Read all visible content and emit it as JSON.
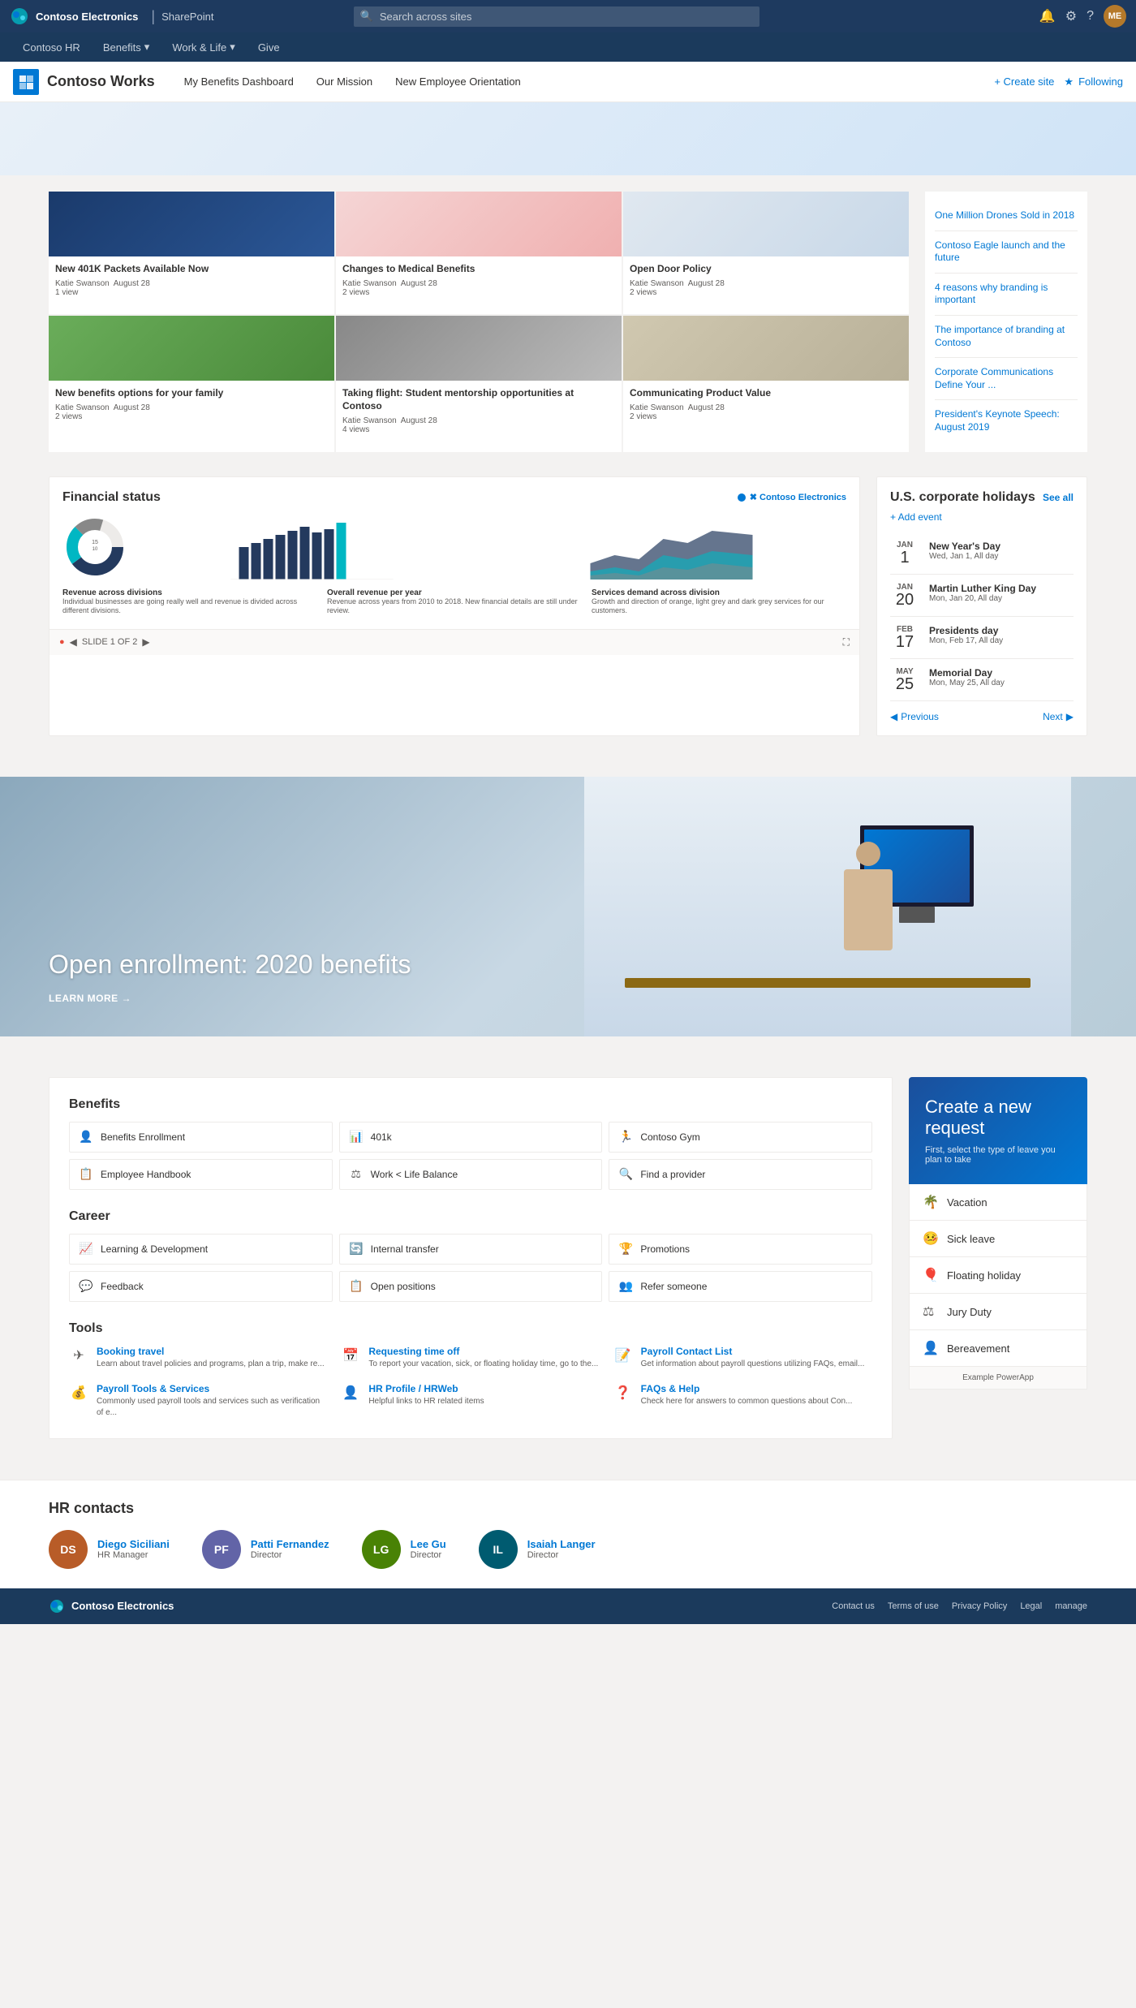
{
  "topNav": {
    "logoText": "Contoso Electronics",
    "divider": "|",
    "sharePointLabel": "SharePoint",
    "searchPlaceholder": "Search across sites",
    "icons": {
      "bell": "🔔",
      "gear": "⚙",
      "help": "?"
    },
    "avatarInitials": "ME"
  },
  "siteNav": {
    "items": [
      {
        "label": "Contoso HR",
        "hasDropdown": false
      },
      {
        "label": "Benefits",
        "hasDropdown": true
      },
      {
        "label": "Work & Life",
        "hasDropdown": true
      },
      {
        "label": "Give",
        "hasDropdown": false
      }
    ]
  },
  "pageNav": {
    "brand": "Contoso Works",
    "links": [
      "My Benefits Dashboard",
      "Our Mission",
      "New Employee Orientation"
    ],
    "createSite": "+ Create site",
    "follow": "Following"
  },
  "news": {
    "items": [
      {
        "title": "New 401K Packets Available Now",
        "author": "Katie Swanson",
        "date": "August 28",
        "views": "1 view",
        "imgType": "blue"
      },
      {
        "title": "Changes to Medical Benefits",
        "author": "Katie Swanson",
        "date": "August 28",
        "views": "2 views",
        "imgType": "baby"
      },
      {
        "title": "Open Door Policy",
        "author": "Katie Swanson",
        "date": "August 28",
        "views": "2 views",
        "imgType": "laptop"
      },
      {
        "title": "New benefits options for your family",
        "author": "Katie Swanson",
        "date": "August 28",
        "views": "2 views",
        "imgType": "family"
      },
      {
        "title": "Taking flight: Student mentorship opportunities at Contoso",
        "author": "Katie Swanson",
        "date": "August 28",
        "views": "4 views",
        "imgType": "meeting"
      },
      {
        "title": "Communicating Product Value",
        "author": "Katie Swanson",
        "date": "August 28",
        "views": "2 views",
        "imgType": "office"
      }
    ],
    "sidebar": [
      "One Million Drones Sold in 2018",
      "Contoso Eagle launch and the future",
      "4 reasons why branding is important",
      "The importance of branding at Contoso",
      "Corporate Communications Define Your ...",
      "President's Keynote Speech: August 2019"
    ]
  },
  "financial": {
    "title": "Financial status",
    "logoText": "✖ Contoso Electronics",
    "captions": [
      {
        "title": "Revenue across divisions",
        "text": "Individual businesses are going really well and revenue is divided across different divisions."
      },
      {
        "title": "Overall revenue per year",
        "text": "Revenue across years from 2010 to 2018. New financial details are still under review."
      },
      {
        "title": "Services demand across division",
        "text": "Growth and direction of orange, light grey and dark grey services for our customers."
      }
    ],
    "slide": "SLIDE 1 OF 2"
  },
  "calendar": {
    "title": "U.S. corporate holidays",
    "seeAll": "See all",
    "addEvent": "+ Add event",
    "events": [
      {
        "month": "JAN",
        "day": "1",
        "name": "New Year's Day",
        "sub": "Wed, Jan 1, All day"
      },
      {
        "month": "JAN",
        "day": "20",
        "name": "Martin Luther King Day",
        "sub": "Mon, Jan 20, All day"
      },
      {
        "month": "FEB",
        "day": "17",
        "name": "Presidents day",
        "sub": "Mon, Feb 17, All day"
      },
      {
        "month": "MAY",
        "day": "25",
        "name": "Memorial Day",
        "sub": "Mon, May 25, All day"
      }
    ],
    "prev": "Previous",
    "next": "Next"
  },
  "heroBanner": {
    "title": "Open enrollment: 2020 benefits",
    "cta": "LEARN MORE →"
  },
  "benefits": {
    "title": "Benefits",
    "links": [
      {
        "icon": "👤",
        "label": "Benefits Enrollment"
      },
      {
        "icon": "📊",
        "label": "401k"
      },
      {
        "icon": "🏃",
        "label": "Contoso Gym"
      },
      {
        "icon": "📋",
        "label": "Employee Handbook"
      },
      {
        "icon": "⚖",
        "label": "Work < Life Balance"
      },
      {
        "icon": "🔍",
        "label": "Find a provider"
      }
    ]
  },
  "career": {
    "title": "Career",
    "links": [
      {
        "icon": "📈",
        "label": "Learning & Development"
      },
      {
        "icon": "🔄",
        "label": "Internal transfer"
      },
      {
        "icon": "🏆",
        "label": "Promotions"
      },
      {
        "icon": "💬",
        "label": "Feedback"
      },
      {
        "icon": "📋",
        "label": "Open positions"
      },
      {
        "icon": "👥",
        "label": "Refer someone"
      }
    ]
  },
  "tools": {
    "title": "Tools",
    "items": [
      {
        "icon": "✈",
        "title": "Booking travel",
        "desc": "Learn about travel policies and programs, plan a trip, make re..."
      },
      {
        "icon": "📅",
        "title": "Requesting time off",
        "desc": "To report your vacation, sick, or floating holiday time, go to the..."
      },
      {
        "icon": "📝",
        "title": "Payroll Contact List",
        "desc": "Get information about payroll questions utilizing FAQs, email..."
      },
      {
        "icon": "💰",
        "title": "Payroll Tools & Services",
        "desc": "Commonly used payroll tools and services such as verification of e..."
      },
      {
        "icon": "👤",
        "title": "HR Profile / HRWeb",
        "desc": "Helpful links to HR related items"
      },
      {
        "icon": "❓",
        "title": "FAQs & Help",
        "desc": "Check here for answers to common questions about Con..."
      }
    ]
  },
  "requestPanel": {
    "title": "Create a new request",
    "subtitle": "First, select the type of leave you plan to take",
    "options": [
      {
        "icon": "🌴",
        "label": "Vacation"
      },
      {
        "icon": "🤒",
        "label": "Sick leave"
      },
      {
        "icon": "🎈",
        "label": "Floating holiday"
      },
      {
        "icon": "⚖",
        "label": "Jury Duty"
      },
      {
        "icon": "👤",
        "label": "Bereavement"
      }
    ],
    "exampleLabel": "Example PowerApp"
  },
  "hrContacts": {
    "title": "HR contacts",
    "contacts": [
      {
        "name": "Diego Siciliani",
        "role": "HR Manager",
        "initials": "DS",
        "color": "#b85c28"
      },
      {
        "name": "Patti Fernandez",
        "role": "Director",
        "initials": "PF",
        "color": "#6264a7"
      },
      {
        "name": "Lee Gu",
        "role": "Director",
        "initials": "LG",
        "color": "#498205"
      },
      {
        "name": "Isaiah Langer",
        "role": "Director",
        "initials": "IL",
        "color": "#005b70"
      }
    ]
  },
  "footer": {
    "logoText": "Contoso Electronics",
    "links": [
      "Contact us",
      "Terms of use",
      "Privacy Policy",
      "Legal",
      "manage"
    ]
  }
}
